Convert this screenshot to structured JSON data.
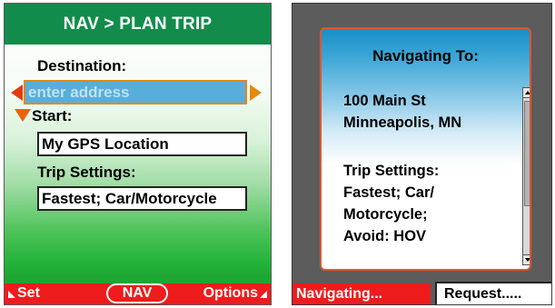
{
  "left_screen": {
    "title": "NAV > PLAN TRIP",
    "destination_label": "Destination:",
    "destination_placeholder": "enter address",
    "start_label": "Start:",
    "start_value": "My GPS Location",
    "trip_settings_label": "Trip Settings:",
    "trip_settings_value": "Fastest; Car/Motorcycle",
    "softkeys": {
      "left": "Set",
      "center": "NAV",
      "right": "Options"
    }
  },
  "right_screen": {
    "dialog": {
      "heading": "Navigating To:",
      "lines": [
        "100 Main St",
        "Minneapolis, MN",
        "Trip Settings:",
        "Fastest; Car/",
        "Motorcycle;",
        "Avoid: HOV"
      ]
    },
    "softkeys": {
      "left": "Navigating...",
      "right": "Request....."
    }
  },
  "colors": {
    "title_bar": "#128c4b",
    "softkey_bar": "#ee1c1c",
    "dialog_border": "#e3542a",
    "destination_field": "#58aedb"
  },
  "icons": [
    "arrow-left-icon",
    "arrow-right-icon",
    "arrow-down-icon",
    "softkey-left-triangle-icon",
    "softkey-right-triangle-icon",
    "scroll-up-icon",
    "scroll-down-icon"
  ]
}
